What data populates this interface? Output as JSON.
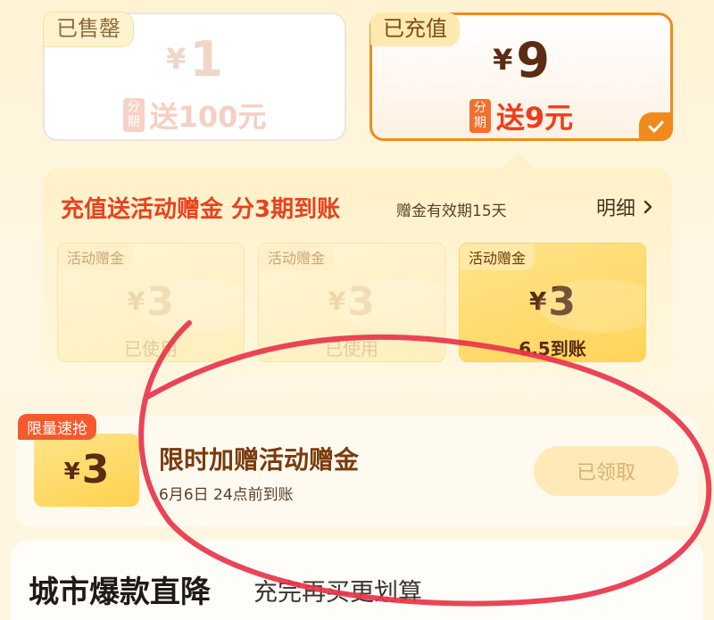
{
  "plans": [
    {
      "tag": "已售罄",
      "yen": "¥",
      "amount": "1",
      "badge": "分期",
      "bonus": "送100元"
    },
    {
      "tag": "已充值",
      "yen": "¥",
      "amount": "9",
      "badge": "分期",
      "bonus": "送9元"
    }
  ],
  "panel": {
    "title": "充值送活动赠金 分3期到账",
    "note": "赠金有效期15天",
    "detail_label": "明细",
    "coupons": [
      {
        "tag": "活动赠金",
        "yen": "¥",
        "amount": "3",
        "status": "已使用"
      },
      {
        "tag": "活动赠金",
        "yen": "¥",
        "amount": "3",
        "status": "已使用"
      },
      {
        "tag": "活动赠金",
        "yen": "¥",
        "amount": "3",
        "status": "6.5到账"
      }
    ]
  },
  "limited": {
    "tag": "限量速抢",
    "yen": "¥",
    "amount": "3",
    "title": "限时加赠活动赠金",
    "subtitle": "6月6日 24点前到账",
    "button_label": "已领取"
  },
  "bottom": {
    "title": "城市爆款直降",
    "subtitle": "充完再买更划算"
  },
  "colors": {
    "accent_orange": "#f08a1c",
    "bonus_red": "#ee3d1a",
    "annotation_red": "#e8344a"
  }
}
